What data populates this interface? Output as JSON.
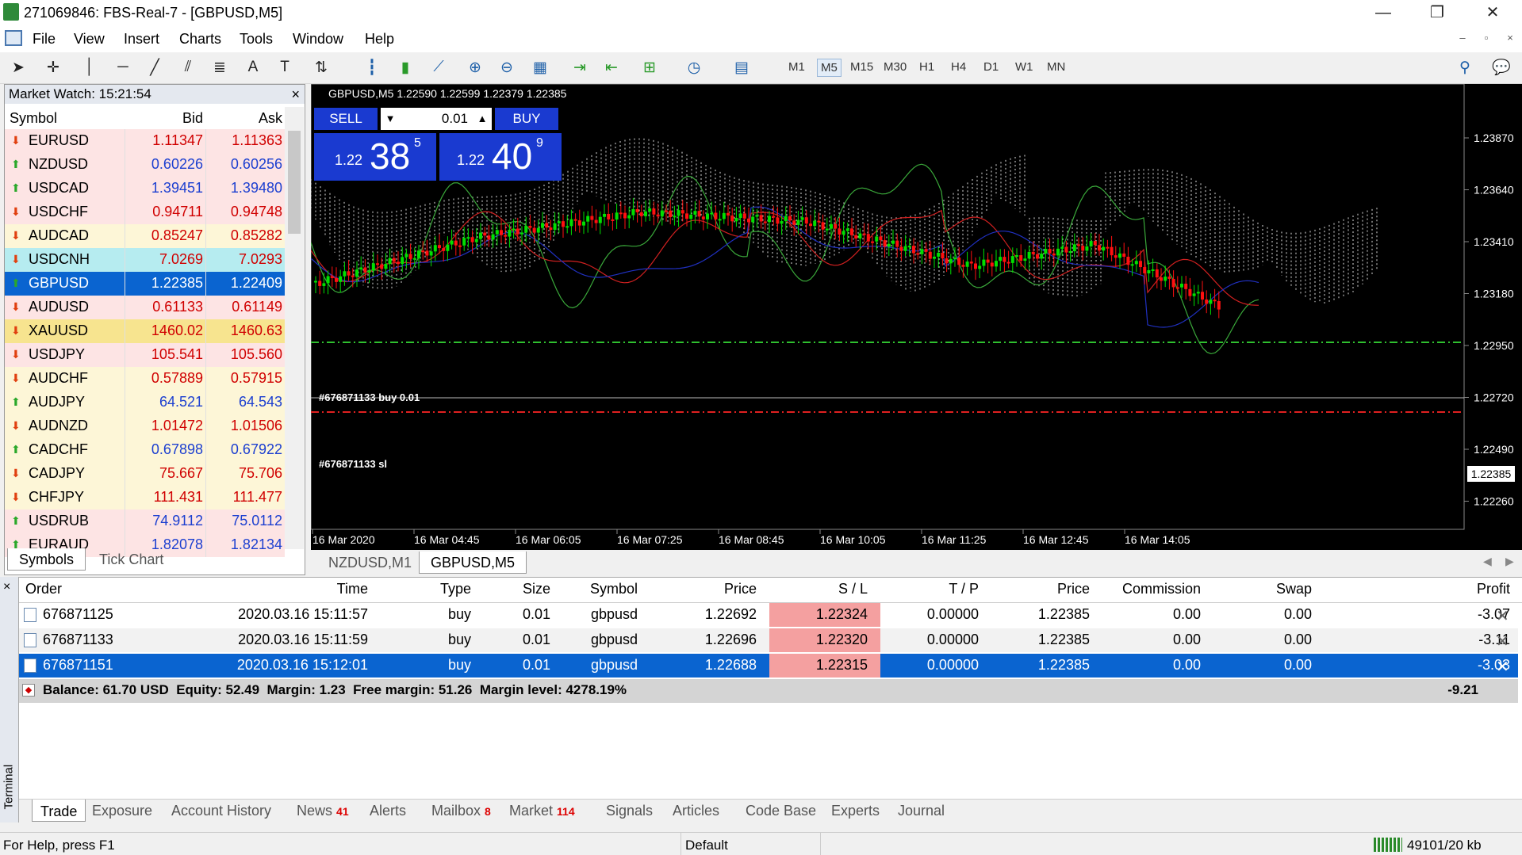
{
  "window": {
    "title": "271069846: FBS-Real-7 - [GBPUSD,M5]",
    "minimize": "—",
    "restore": "❐",
    "close": "✕"
  },
  "menu": [
    "File",
    "View",
    "Insert",
    "Charts",
    "Tools",
    "Window",
    "Help"
  ],
  "mdi": [
    "–",
    "▫",
    "×"
  ],
  "timeframes": [
    "M1",
    "M5",
    "M15",
    "M30",
    "H1",
    "H4",
    "D1",
    "W1",
    "MN"
  ],
  "selected_timeframe": "M5",
  "market_watch": {
    "title": "Market Watch: 15:21:54",
    "close": "×",
    "columns": [
      "Symbol",
      "Bid",
      "Ask"
    ],
    "rows": [
      {
        "symbol": "EURUSD",
        "bid": "1.11347",
        "ask": "1.11363",
        "dir": "down",
        "bg": "#fde4e4",
        "color": "#d00000"
      },
      {
        "symbol": "NZDUSD",
        "bid": "0.60226",
        "ask": "0.60256",
        "dir": "up",
        "bg": "#fde4e4",
        "color": "#1c3fd0"
      },
      {
        "symbol": "USDCAD",
        "bid": "1.39451",
        "ask": "1.39480",
        "dir": "up",
        "bg": "#fde4e4",
        "color": "#1c3fd0"
      },
      {
        "symbol": "USDCHF",
        "bid": "0.94711",
        "ask": "0.94748",
        "dir": "down",
        "bg": "#fde4e4",
        "color": "#d00000"
      },
      {
        "symbol": "AUDCAD",
        "bid": "0.85247",
        "ask": "0.85282",
        "dir": "down",
        "bg": "#fdf6d7",
        "color": "#d00000"
      },
      {
        "symbol": "USDCNH",
        "bid": "7.0269",
        "ask": "7.0293",
        "dir": "down",
        "bg": "#b6ecf0",
        "color": "#d00000"
      },
      {
        "symbol": "GBPUSD",
        "bid": "1.22385",
        "ask": "1.22409",
        "dir": "up",
        "bg": "#0a64d0",
        "color": "#ffffff"
      },
      {
        "symbol": "AUDUSD",
        "bid": "0.61133",
        "ask": "0.61149",
        "dir": "down",
        "bg": "#fde4e4",
        "color": "#d00000"
      },
      {
        "symbol": "XAUUSD",
        "bid": "1460.02",
        "ask": "1460.63",
        "dir": "down",
        "bg": "#f7e48f",
        "color": "#d00000"
      },
      {
        "symbol": "USDJPY",
        "bid": "105.541",
        "ask": "105.560",
        "dir": "down",
        "bg": "#fde4e4",
        "color": "#d00000"
      },
      {
        "symbol": "AUDCHF",
        "bid": "0.57889",
        "ask": "0.57915",
        "dir": "down",
        "bg": "#fdf6d7",
        "color": "#d00000"
      },
      {
        "symbol": "AUDJPY",
        "bid": "64.521",
        "ask": "64.543",
        "dir": "up",
        "bg": "#fdf6d7",
        "color": "#1c3fd0"
      },
      {
        "symbol": "AUDNZD",
        "bid": "1.01472",
        "ask": "1.01506",
        "dir": "down",
        "bg": "#fdf6d7",
        "color": "#d00000"
      },
      {
        "symbol": "CADCHF",
        "bid": "0.67898",
        "ask": "0.67922",
        "dir": "up",
        "bg": "#fdf6d7",
        "color": "#1c3fd0"
      },
      {
        "symbol": "CADJPY",
        "bid": "75.667",
        "ask": "75.706",
        "dir": "down",
        "bg": "#fdf6d7",
        "color": "#d00000"
      },
      {
        "symbol": "CHFJPY",
        "bid": "111.431",
        "ask": "111.477",
        "dir": "down",
        "bg": "#fdf6d7",
        "color": "#d00000"
      },
      {
        "symbol": "USDRUB",
        "bid": "74.9112",
        "ask": "75.0112",
        "dir": "up",
        "bg": "#fde4e4",
        "color": "#1c3fd0"
      },
      {
        "symbol": "EURAUD",
        "bid": "1.82078",
        "ask": "1.82134",
        "dir": "up",
        "bg": "#fde4e4",
        "color": "#1c3fd0"
      }
    ],
    "tabs": [
      "Symbols",
      "Tick Chart"
    ]
  },
  "chart": {
    "header": "GBPUSD,M5  1.22590 1.22599 1.22379 1.22385",
    "sell_label": "SELL",
    "buy_label": "BUY",
    "lot": "0.01",
    "sell_big": "38",
    "sell_small": "1.22",
    "sell_sup": "5",
    "buy_big": "40",
    "buy_small": "1.22",
    "buy_sup": "9",
    "order_label_buy": "#676871133 buy 0.01",
    "order_label_sl": "#676871133 sl",
    "current_price": "1.22385",
    "price_ticks": [
      "1.23870",
      "1.23640",
      "1.23410",
      "1.23180",
      "1.22950",
      "1.22720",
      "1.22490",
      "1.22260"
    ],
    "time_ticks": [
      "16 Mar 2020",
      "16 Mar 04:45",
      "16 Mar 06:05",
      "16 Mar 07:25",
      "16 Mar 08:45",
      "16 Mar 10:05",
      "16 Mar 11:25",
      "16 Mar 12:45",
      "16 Mar 14:05"
    ],
    "tabs": [
      "NZDUSD,M1",
      "GBPUSD,M5"
    ],
    "bg": "#000000",
    "bull": "#00e000",
    "bear": "#ff1010"
  },
  "terminal": {
    "side_label": "Terminal",
    "columns": [
      "Order",
      "Time",
      "Type",
      "Size",
      "Symbol",
      "Price",
      "S / L",
      "T / P",
      "Price",
      "Commission",
      "Swap",
      "Profit"
    ],
    "rows": [
      {
        "order": "676871125",
        "time": "2020.03.16 15:11:57",
        "type": "buy",
        "size": "0.01",
        "symbol": "gbpusd",
        "price": "1.22692",
        "sl": "1.22324",
        "tp": "0.00000",
        "cur": "1.22385",
        "commission": "0.00",
        "swap": "0.00",
        "profit": "-3.07"
      },
      {
        "order": "676871133",
        "time": "2020.03.16 15:11:59",
        "type": "buy",
        "size": "0.01",
        "symbol": "gbpusd",
        "price": "1.22696",
        "sl": "1.22320",
        "tp": "0.00000",
        "cur": "1.22385",
        "commission": "0.00",
        "swap": "0.00",
        "profit": "-3.11"
      },
      {
        "order": "676871151",
        "time": "2020.03.16 15:12:01",
        "type": "buy",
        "size": "0.01",
        "symbol": "gbpusd",
        "price": "1.22688",
        "sl": "1.22315",
        "tp": "0.00000",
        "cur": "1.22385",
        "commission": "0.00",
        "swap": "0.00",
        "profit": "-3.03"
      }
    ],
    "balance": "Balance: 61.70 USD  Equity: 52.49  Margin: 1.23  Free margin: 51.26  Margin level: 4278.19%",
    "total_profit": "-9.21",
    "tabs": [
      {
        "label": "Trade",
        "badge": ""
      },
      {
        "label": "Exposure",
        "badge": ""
      },
      {
        "label": "Account History",
        "badge": ""
      },
      {
        "label": "News",
        "badge": "41"
      },
      {
        "label": "Alerts",
        "badge": ""
      },
      {
        "label": "Mailbox",
        "badge": "8"
      },
      {
        "label": "Market",
        "badge": "114"
      },
      {
        "label": "Signals",
        "badge": ""
      },
      {
        "label": "Articles",
        "badge": ""
      },
      {
        "label": "Code Base",
        "badge": ""
      },
      {
        "label": "Experts",
        "badge": ""
      },
      {
        "label": "Journal",
        "badge": ""
      }
    ]
  },
  "status": {
    "help": "For Help, press F1",
    "profile": "Default",
    "traffic": "49101/20 kb"
  }
}
